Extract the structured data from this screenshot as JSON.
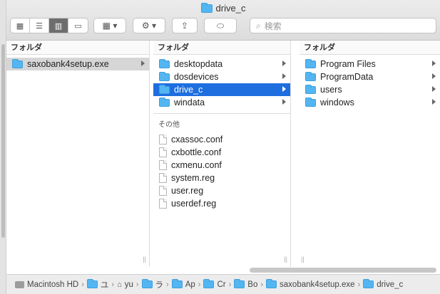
{
  "window": {
    "title": "drive_c"
  },
  "toolbar": {
    "view_icons": [
      "icon-view",
      "list-view",
      "column-view",
      "gallery-view"
    ],
    "group_label": "▾",
    "action_label": "▾",
    "search_placeholder": "検索"
  },
  "columns": [
    {
      "header": "フォルダ",
      "items": [
        {
          "name": "saxobank4setup.exe",
          "type": "folder",
          "state": "selgray",
          "arrow": true
        }
      ]
    },
    {
      "header": "フォルダ",
      "items": [
        {
          "name": "desktopdata",
          "type": "folder",
          "arrow": true
        },
        {
          "name": "dosdevices",
          "type": "folder",
          "arrow": true
        },
        {
          "name": "drive_c",
          "type": "folder",
          "arrow": true,
          "state": "sel"
        },
        {
          "name": "windata",
          "type": "folder",
          "arrow": true
        }
      ],
      "other_header": "その他",
      "other_items": [
        "cxassoc.conf",
        "cxbottle.conf",
        "cxmenu.conf",
        "system.reg",
        "user.reg",
        "userdef.reg"
      ]
    },
    {
      "header": "フォルダ",
      "items": [
        {
          "name": "Program Files",
          "type": "folder",
          "arrow": true
        },
        {
          "name": "ProgramData",
          "type": "folder",
          "arrow": true
        },
        {
          "name": "users",
          "type": "folder",
          "arrow": true
        },
        {
          "name": "windows",
          "type": "folder",
          "arrow": true
        }
      ]
    }
  ],
  "pathbar": {
    "crumbs": [
      "Macintosh HD",
      "ユ",
      "yu",
      "ラ",
      "Ap",
      "Cr",
      "Bo",
      "saxobank4setup.exe",
      "drive_c"
    ]
  }
}
